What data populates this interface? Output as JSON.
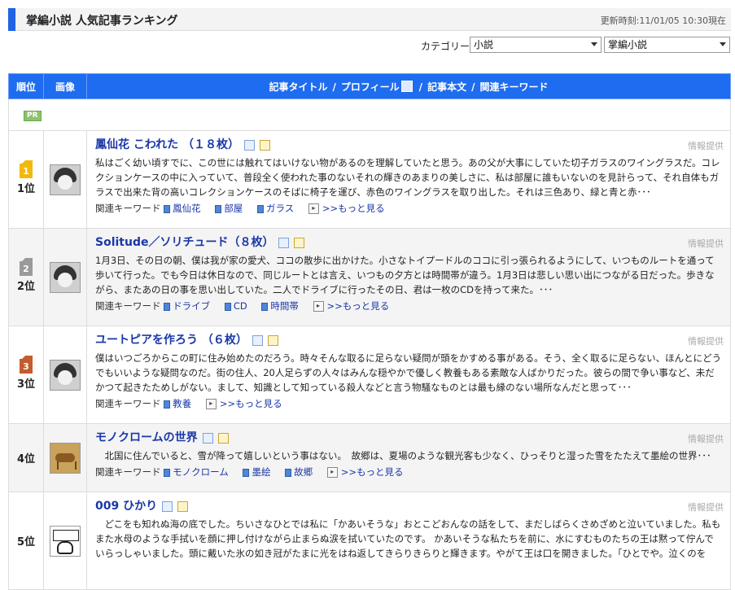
{
  "header": {
    "title": "掌編小説 人気記事ランキング",
    "updated": "更新時刻:11/01/05 10:30現在"
  },
  "category": {
    "label": "カテゴリー",
    "select1": "小説",
    "select2": "掌編小説"
  },
  "table": {
    "col_rank": "順位",
    "col_image": "画像",
    "col_title": "記事タイトル",
    "col_profile": "プロフィール",
    "col_body": "記事本文",
    "col_keywords": "関連キーワード",
    "sep": "/"
  },
  "pr_label": "PR",
  "info_label": "情報提供",
  "keyword_label": "関連キーワード",
  "more_label": ">>もっと見る",
  "articles": [
    {
      "rank": "1位",
      "crown_num": "1",
      "title": "鳳仙花 こわれた （１８枚）",
      "excerpt": "私はごく幼い頃すでに、この世には触れてはいけない物があるのを理解していたと思う。あの父が大事にしていた切子ガラスのワイングラスだ。コレクションケースの中に入っていて、普段全く使われた事のないそれの輝きのあまりの美しさに、私は部屋に誰もいないのを見計らって、それ自体もガラスで出来た背の高いコレクションケースのそばに椅子を運び、赤色のワイングラスを取り出した。それは三色あり、緑と青と赤･･･",
      "keywords": [
        "鳳仙花",
        "部屋",
        "ガラス"
      ]
    },
    {
      "rank": "2位",
      "crown_num": "2",
      "title": "Solitude／ソリチュード（８枚）",
      "excerpt": "1月3日、その日の朝、僕は我が家の愛犬、ココの散歩に出かけた。小さなトイプードルのココに引っ張られるようにして、いつものルートを通って歩いて行った。でも今日は休日なので、同じルートとは言え、いつもの夕方とは時間帯が違う。1月3日は悲しい思い出につながる日だった。歩きながら、またあの日の事を思い出していた。二人でドライブに行ったその日、君は一枚のCDを持って来た。･･･",
      "keywords": [
        "ドライブ",
        "CD",
        "時間帯"
      ]
    },
    {
      "rank": "3位",
      "crown_num": "3",
      "title": "ユートピアを作ろう （６枚）",
      "excerpt": "僕はいつごろからこの町に住み始めたのだろう。時々そんな取るに足らない疑問が頭をかすめる事がある。そう、全く取るに足らない、ほんとにどうでもいいような疑問なのだ。街の住人、20人足らずの人々はみんな穏やかで優しく教養もある素敵な人ばかりだった。彼らの間で争い事など、未だかつて起きたためしがない。まして、知識として知っている殺人などと言う物騒なものとは最も縁のない場所なんだと思って･･･",
      "keywords": [
        "教養"
      ]
    },
    {
      "rank": "4位",
      "crown_num": "",
      "title": "モノクロームの世界",
      "excerpt": "　北国に住んでいると、雪が降って嬉しいという事はない。　故郷は、夏場のような観光客も少なく、ひっそりと湿った雪をたたえて墨絵の世界･･･",
      "keywords": [
        "モノクローム",
        "墨絵",
        "故郷"
      ]
    },
    {
      "rank": "5位",
      "crown_num": "",
      "title": "009 ひかり",
      "excerpt": "　どこをも知れぬ海の底でした。ちいさなひとでは私に「かあいそうな」おとこどおんなの話をして、まだしばらくさめざめと泣いていました。私もまた水母のような手拭いを顔に押し付けながら止まらぬ涙を拭いていたのです。 かあいそうな私たちを前に、水にすむものたちの王は黙って佇んでいらっしゃいました。頭に戴いた氷の如き冠がたまに光をはね返してきらりきらりと輝きます。やがて王は口を開きました。「ひとでや。泣くのを",
      "keywords": []
    }
  ]
}
